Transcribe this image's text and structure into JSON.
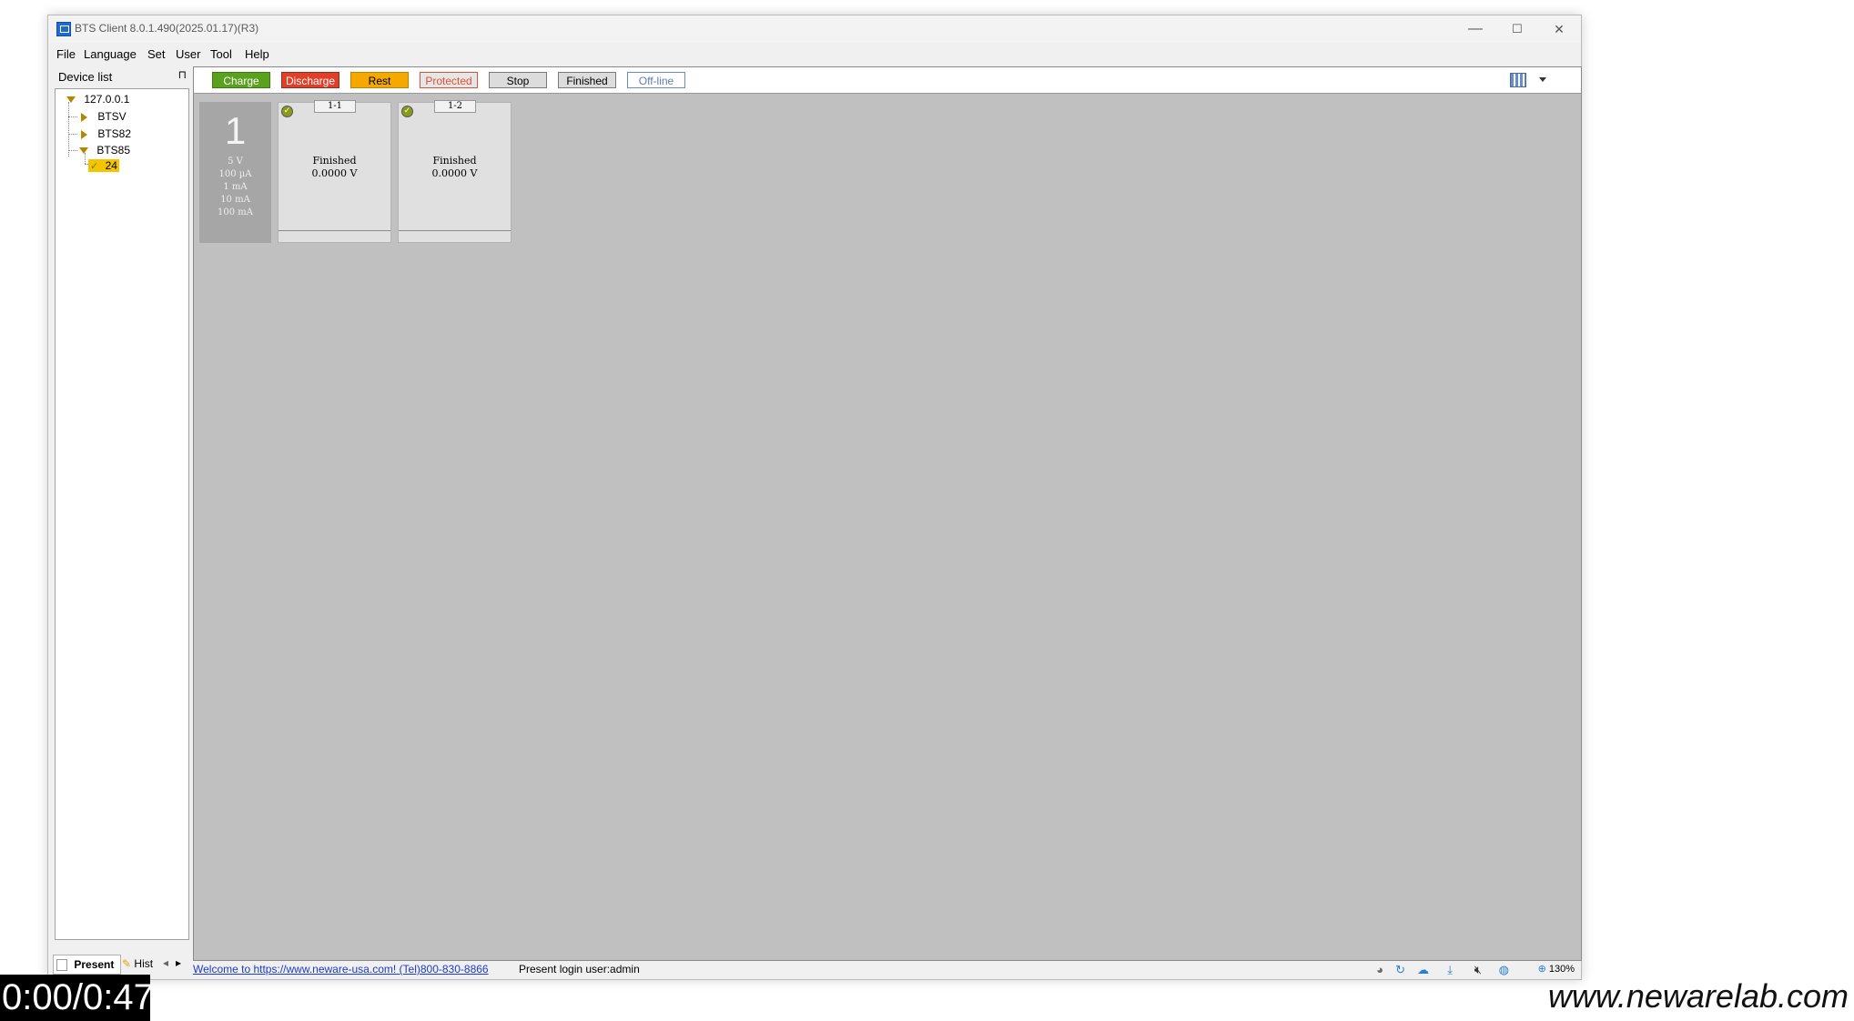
{
  "window": {
    "title": "BTS Client 8.0.1.490(2025.01.17)(R3)",
    "minimize": "—",
    "maximize": "☐",
    "close": "✕"
  },
  "menu": [
    "File",
    "Language",
    "Set",
    "User",
    "Tool",
    "Help"
  ],
  "device_panel": {
    "title": "Device list",
    "pin": "⊓",
    "tree": {
      "root": "127.0.0.1",
      "children": [
        "BTSV",
        "BTS82",
        "BTS85"
      ],
      "bts85_child": "24"
    },
    "tabs": {
      "present": "Present",
      "history": "Hist",
      "prev": "◂",
      "next": "▸"
    }
  },
  "legend": [
    {
      "label": "Charge",
      "bg": "#5aa21e",
      "fg": "#ffffff",
      "border": "#3c7a10"
    },
    {
      "label": "Discharge",
      "bg": "#e0402a",
      "fg": "#ffffff",
      "border": "#a02a18"
    },
    {
      "label": "Rest",
      "bg": "#f5a800",
      "fg": "#000000",
      "border": "#c08000"
    },
    {
      "label": "Protected",
      "bg": "#e6e6e6",
      "fg": "#e05030",
      "border": "#e05030"
    },
    {
      "label": "Stop",
      "bg": "#dcdcdc",
      "fg": "#000000",
      "border": "#7a7a7a"
    },
    {
      "label": "Finished",
      "bg": "#dcdcdc",
      "fg": "#000000",
      "border": "#7a7a7a"
    },
    {
      "label": "Off-line",
      "bg": "#ffffff",
      "fg": "#5a7fb0",
      "border": "#6a8cc0"
    }
  ],
  "unit": {
    "number": "1",
    "specs": [
      "5 V",
      "100 µA",
      "1 mA",
      "10 mA",
      "100 mA"
    ]
  },
  "channels": [
    {
      "id": "1-1",
      "status": "Finished",
      "voltage": "0.0000 V"
    },
    {
      "id": "1-2",
      "status": "Finished",
      "voltage": "0.0000 V"
    }
  ],
  "status_bar": {
    "welcome": "Welcome to https://www.neware-usa.com! (Tel)800-830-8866",
    "login": "Present login user:admin",
    "zoom": "130%"
  },
  "overlay": {
    "timer": "0:00/0:47",
    "watermark": "www.newarelab.com"
  }
}
